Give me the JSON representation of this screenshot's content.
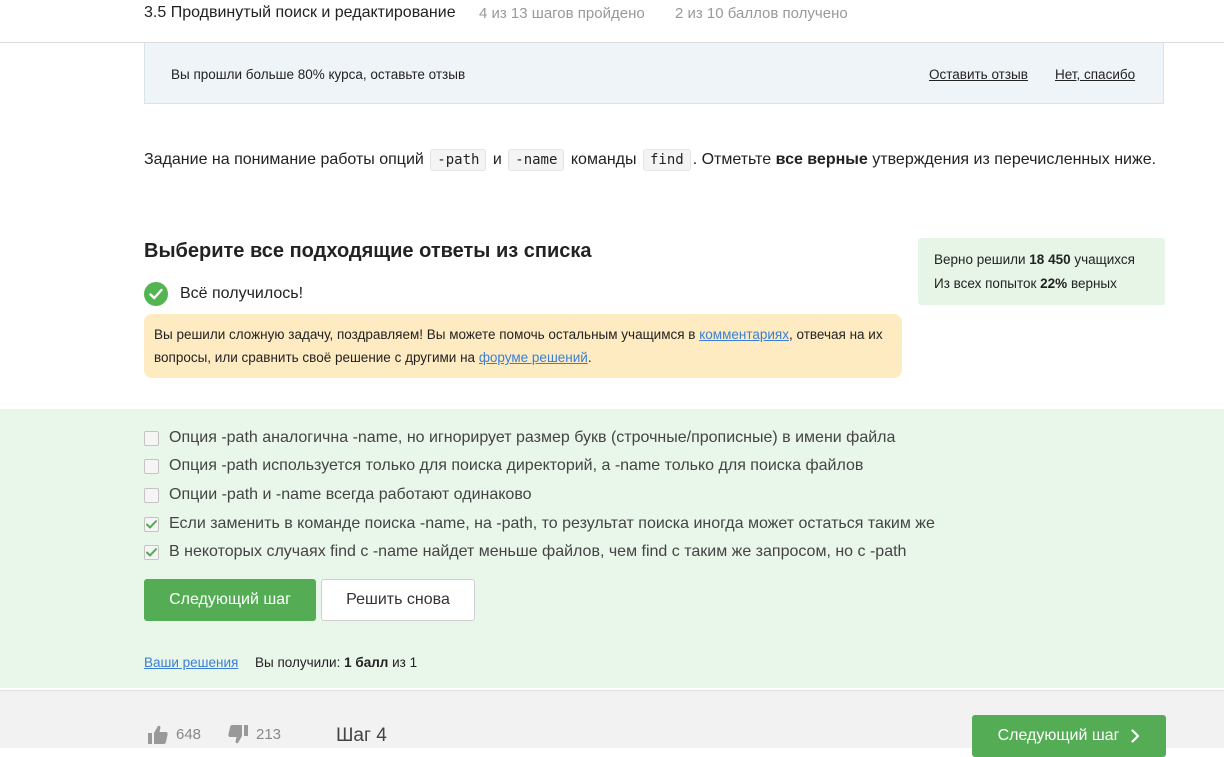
{
  "header": {
    "lesson_title": "3.5 Продвинутый поиск и редактирование",
    "steps_progress": "4 из 13 шагов пройдено",
    "points_progress": "2 из 10 баллов  получено"
  },
  "feedback_banner": {
    "text": "Вы прошли больше 80% курса, оставьте отзыв",
    "leave_review": "Оставить отзыв",
    "no_thanks": "Нет, спасибо"
  },
  "task": {
    "t1": "Задание на понимание работы опций ",
    "code1": "-path",
    "t2": " и ",
    "code2": "-name",
    "t3": " команды ",
    "code3": "find",
    "t4": ". Отметьте ",
    "bold": "все верные",
    "t5": " утверждения из перечисленных ниже."
  },
  "question": {
    "title": "Выберите все подходящие ответы из списка",
    "success_text": "Всё получилось!"
  },
  "hint": {
    "t1": "Вы решили сложную задачу, поздравляем! Вы можете помочь остальным учащимся в ",
    "link1": "комментариях",
    "t2": ", отвечая на их вопросы, или сравнить своё решение с другими на ",
    "link2": "форуме решений",
    "t3": "."
  },
  "stats": {
    "solved_prefix": "Верно решили ",
    "solved_count": "18 450",
    "solved_suffix": " учащихся",
    "attempts_prefix": "Из всех попыток ",
    "attempts_percent": "22%",
    "attempts_suffix": " верных"
  },
  "options": [
    {
      "label": "Опция -path аналогична -name, но игнорирует размер букв (строчные/прописные) в имени файла",
      "checked": false
    },
    {
      "label": "Опция -path используется только для поиска директорий, а -name только для поиска файлов",
      "checked": false
    },
    {
      "label": "Опции -path и -name всегда работают одинаково",
      "checked": false
    },
    {
      "label": "Если заменить в команде поиска -name, на -path, то результат поиска иногда может остаться таким же",
      "checked": true
    },
    {
      "label": "В некоторых случаях find с -name найдет меньше файлов, чем find с таким же запросом, но с -path",
      "checked": true
    }
  ],
  "actions": {
    "next_step": "Следующий шаг",
    "solve_again": "Решить снова"
  },
  "result": {
    "your_solutions": "Ваши решения",
    "score_prefix": "Вы получили: ",
    "score_value": "1 балл",
    "score_suffix": " из 1"
  },
  "footer": {
    "likes": "648",
    "dislikes": "213",
    "step_label": "Шаг 4",
    "next_step": "Следующий шаг"
  },
  "colors": {
    "accent_green": "#54ad54",
    "link_blue": "#3a7fd6",
    "answers_bg": "#e9f6ea",
    "hint_bg": "#ffebc2"
  }
}
